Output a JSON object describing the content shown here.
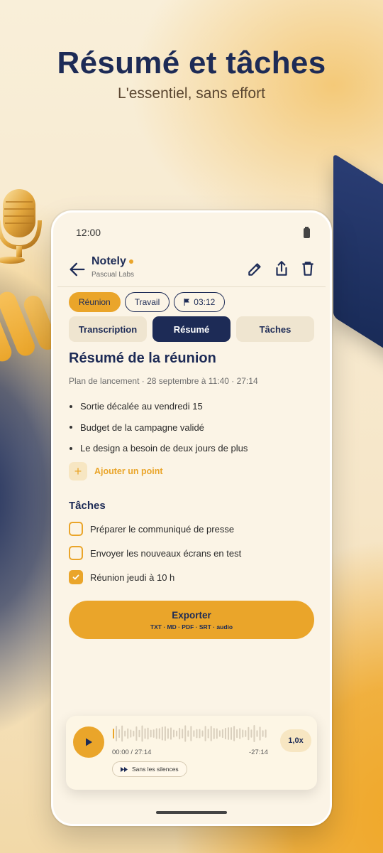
{
  "hero": {
    "title": "Résumé et tâches",
    "subtitle": "L'essentiel, sans effort"
  },
  "status_bar": {
    "time": "12:00",
    "battery_icon": "battery-icon"
  },
  "app_bar": {
    "app_name": "Notely",
    "organization": "Pascual Labs",
    "icons": [
      "back-arrow-icon",
      "edit-icon",
      "share-icon",
      "delete-icon"
    ]
  },
  "chips": {
    "category": "Réunion",
    "tag": "Travail",
    "flag_time": "03:12"
  },
  "tabs": [
    {
      "label": "Transcription",
      "active": false
    },
    {
      "label": "Résumé",
      "active": true
    },
    {
      "label": "Tâches",
      "active": false
    }
  ],
  "summary": {
    "title": "Résumé de la réunion",
    "meta": "Plan de lancement · 28 septembre à 11:40 · 27:14",
    "points": [
      "Sortie décalée au vendredi 15",
      "Budget de la campagne validé",
      "Le design a besoin de deux jours de plus"
    ],
    "add_point_label": "Ajouter un point"
  },
  "tasks": {
    "title": "Tâches",
    "items": [
      {
        "label": "Préparer le communiqué de presse",
        "checked": false
      },
      {
        "label": "Envoyer les nouveaux écrans en test",
        "checked": false
      },
      {
        "label": "Réunion jeudi à 10 h",
        "checked": true
      }
    ]
  },
  "export": {
    "label": "Exporter",
    "formats": "TXT · MD · PDF · SRT · audio"
  },
  "player": {
    "position": "00:00 / 27:14",
    "remaining": "-27:14",
    "speed": "1,0x",
    "skip_silences_label": "Sans les silences",
    "progress": 0
  },
  "colors": {
    "navy": "#1d2b56",
    "accent": "#eaa52a",
    "surface": "#fbf4e6"
  }
}
